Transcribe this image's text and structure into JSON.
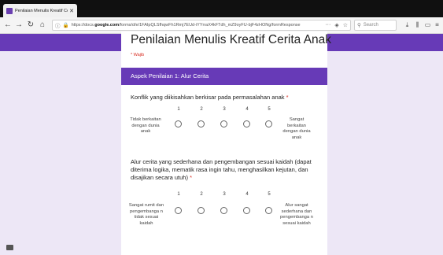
{
  "browser": {
    "tab_title": "Penilaian Menulis Kreatif Cerita",
    "url_prefix": "https://docs.",
    "url_domain": "google.com",
    "url_rest": "/forms/d/e/1FAIpQLSfhqwFh1Rmj7EUd-iYYrraX4kFTdh_mZ9oyFU-bjF4zHONg/formResponse",
    "search_placeholder": "Search",
    "icons": {
      "back": "back-arrow-icon",
      "forward": "forward-arrow-icon",
      "reload": "reload-icon",
      "home": "home-icon",
      "info": "info-icon",
      "lock": "lock-icon",
      "menu": "ellipsis-icon",
      "pocket": "pocket-icon",
      "bookmark": "star-icon",
      "download": "download-icon",
      "library": "library-icon",
      "sidebar": "sidebar-icon",
      "hamburger": "hamburger-menu-icon"
    }
  },
  "form": {
    "title": "Penilaian Menulis Kreatif Cerita Anak",
    "required_note": "* Wajib",
    "section_title": "Aspek Penilaian 1: Alur Cerita",
    "scale_numbers": [
      "1",
      "2",
      "3",
      "4",
      "5"
    ],
    "questions": [
      {
        "text": "Konflik yang diikisahkan berkisar pada permasalahan anak",
        "required_mark": "*",
        "low_label": "Tidak berkaitan dengan dunia anak",
        "high_label": "Sangat berkaitan dengan dunia anak"
      },
      {
        "text": "Alur cerita yang sederhana dan pengembangan sesuai kaidah (dapat diterima logika, mematik rasa ingin tahu, menghasilkan kejutan, dan disajikan secara utuh)",
        "required_mark": "*",
        "low_label": "Sangat rumit dan pengembanga n tidak sesuai kaidah",
        "high_label": "Alur sangat sederhana dan pengembanga n sesuai kaidah"
      }
    ]
  },
  "colors": {
    "accent": "#673ab7",
    "page_bg": "#ede7f6",
    "required": "#d93025"
  }
}
